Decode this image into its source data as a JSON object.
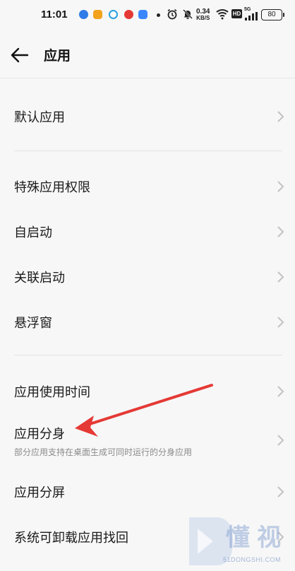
{
  "status_bar": {
    "time": "11:01",
    "net_speed_value": "0.34",
    "net_speed_unit": "KB/S",
    "hd_badge": "HD",
    "signal_label": "5G",
    "battery_level": "80"
  },
  "header": {
    "title": "应用"
  },
  "menu": {
    "items": [
      {
        "label": "默认应用"
      },
      {
        "label": "特殊应用权限"
      },
      {
        "label": "自启动"
      },
      {
        "label": "关联启动"
      },
      {
        "label": "悬浮窗"
      },
      {
        "label": "应用使用时间"
      },
      {
        "label": "应用分身",
        "description": "部分应用支持在桌面生成可同时运行的分身应用"
      },
      {
        "label": "应用分屏"
      },
      {
        "label": "系统可卸载应用找回"
      }
    ]
  },
  "annotation": {
    "color": "#e53935"
  },
  "watermark": {
    "text": "懂视",
    "domain": "51DONGSHI.COM"
  }
}
